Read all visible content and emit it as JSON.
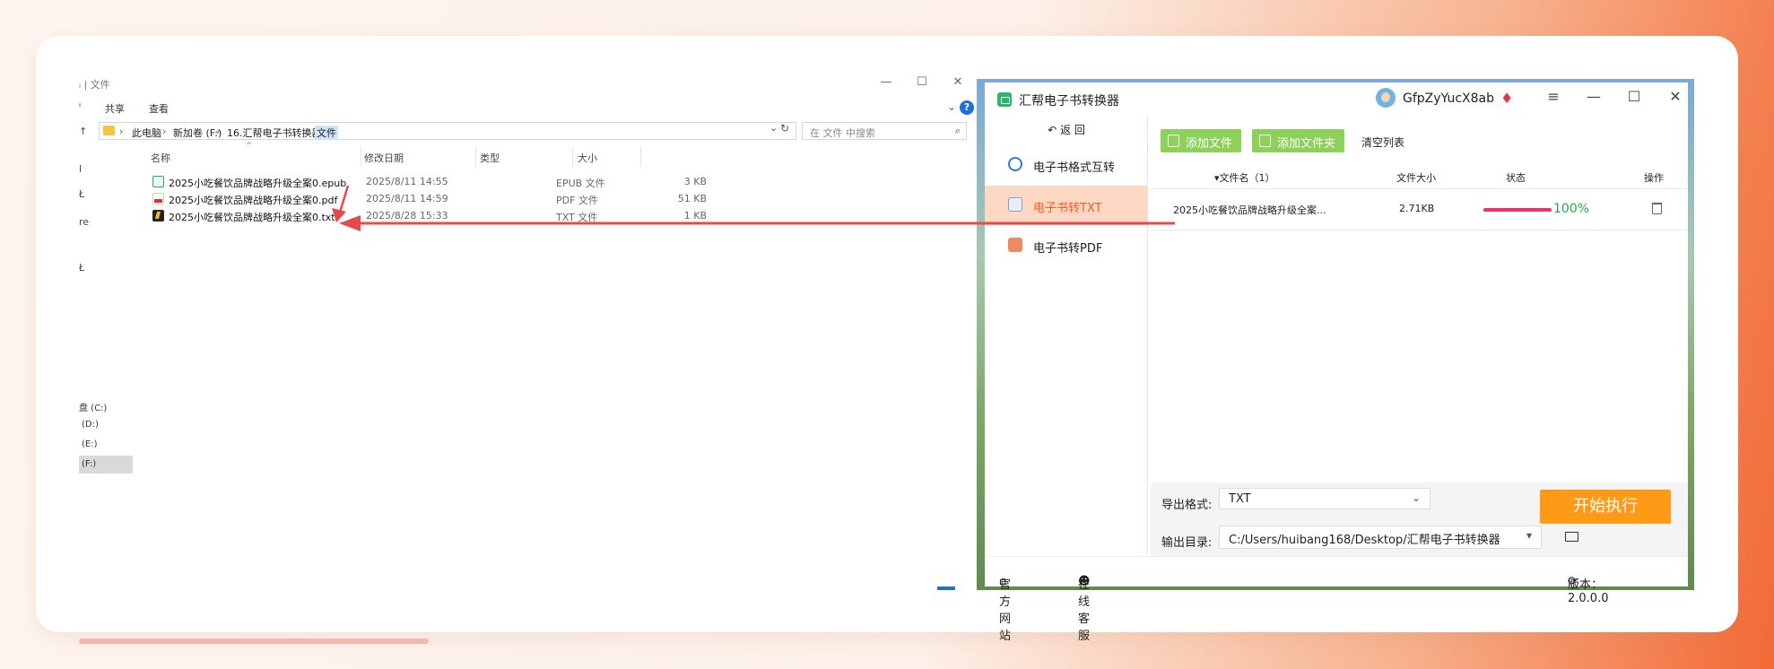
{
  "explorer": {
    "title": "文件",
    "title_prefix": "ᵢ |",
    "window_controls": [
      "—",
      "☐",
      "✕"
    ],
    "ribbon": [
      "共享",
      "查看"
    ],
    "ribbon_left_cut": "ᴵ",
    "breadcrumb": [
      "此电脑",
      "新加卷 (F:)",
      "16.汇帮电子书转换器",
      "文件"
    ],
    "search_placeholder": "在 文件 中搜索",
    "columns": [
      "名称",
      "修改日期",
      "类型",
      "大小"
    ],
    "files": [
      {
        "name": "2025小吃餐饮品牌战略升级全案0.epub",
        "date": "2025/8/11 14:55",
        "type": "EPUB 文件",
        "size": "3 KB",
        "icon": "epub-icon"
      },
      {
        "name": "2025小吃餐饮品牌战略升级全案0.pdf",
        "date": "2025/8/11 14:59",
        "type": "PDF 文件",
        "size": "51 KB",
        "icon": "pdf-icon"
      },
      {
        "name": "2025小吃餐饮品牌战略升级全案0.txt",
        "date": "2025/8/28 15:33",
        "type": "TXT 文件",
        "size": "1 KB",
        "icon": "txt-icon"
      }
    ],
    "nav_cut": [
      "l",
      "Ł",
      "re",
      "Ł"
    ],
    "drives": [
      "盘 (C:)",
      "(D:)",
      "(E:)",
      "(F:)"
    ]
  },
  "app": {
    "title": "汇帮电子书转换器",
    "username": "GfpZyYucX8ab",
    "window_controls": [
      "≡",
      "—",
      "☐",
      "✕"
    ],
    "back_label": "返 回",
    "sidebar": [
      {
        "label": "电子书格式互转",
        "icon": "swap-icon"
      },
      {
        "label": "电子书转TXT",
        "icon": "txt-doc-icon",
        "active": true
      },
      {
        "label": "电子书转PDF",
        "icon": "pdf-icon"
      }
    ],
    "toolbar": {
      "add_file": "添加文件",
      "add_folder": "添加文件夹",
      "clear": "清空列表"
    },
    "table": {
      "headers": {
        "name": "文件名（1）",
        "size": "文件大小",
        "status": "状态",
        "action": "操作"
      },
      "rows": [
        {
          "name": "2025小吃餐饮品牌战略升级全案...",
          "size": "2.71KB",
          "progress_label": "100%",
          "progress": 1.0
        }
      ]
    },
    "export_format_label": "导出格式:",
    "export_format_value": "TXT",
    "output_dir_label": "输出目录:",
    "output_dir_value": "C:/Users/huibang168/Desktop/汇帮电子书转换器",
    "start_label": "开始执行",
    "footer": {
      "website": "官方网站",
      "support": "在线客服",
      "version": "版本：2.0.0.0"
    }
  },
  "colors": {
    "accent_orange": "#ff9a17",
    "active_text": "#ff5a1f",
    "green_button": "#8dd05a",
    "progress": "#e8346f",
    "arrow": "#e84a4a"
  }
}
